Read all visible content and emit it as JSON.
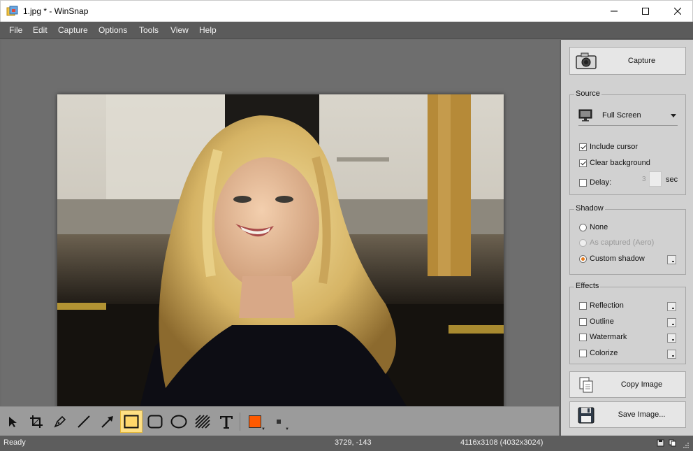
{
  "window": {
    "title": "1.jpg * - WinSnap",
    "app_icon": "winsnap-icon",
    "controls": [
      "minimize-icon",
      "maximize-icon",
      "close-icon"
    ]
  },
  "menu": [
    "File",
    "Edit",
    "Capture",
    "Options",
    "Tools",
    "View",
    "Help"
  ],
  "toolbar": {
    "tools": [
      "pointer-icon",
      "crop-icon",
      "pen-icon",
      "line-icon",
      "arrow-icon",
      "highlight-rectangle-icon",
      "rounded-rectangle-icon",
      "ellipse-icon",
      "hatch-icon",
      "text-icon"
    ],
    "active_tool": "highlight-rectangle-icon",
    "color": "#ff5a00"
  },
  "panel": {
    "capture_label": "Capture",
    "source": {
      "title": "Source",
      "selected": "Full Screen",
      "include_cursor": {
        "label": "Include cursor",
        "checked": true
      },
      "clear_background": {
        "label": "Clear background",
        "checked": true
      },
      "delay": {
        "label": "Delay:",
        "checked": false,
        "value": "3",
        "unit": "sec"
      }
    },
    "shadow": {
      "title": "Shadow",
      "none": "None",
      "as_captured": "As captured (Aero)",
      "custom": "Custom shadow",
      "selected": "Custom shadow"
    },
    "effects": {
      "title": "Effects",
      "reflection": "Reflection",
      "outline": "Outline",
      "watermark": "Watermark",
      "colorize": "Colorize"
    },
    "copy_label": "Copy Image",
    "save_label": "Save Image..."
  },
  "status": {
    "state": "Ready",
    "cursor": "3729, -143",
    "dimensions": "4116x3108 (4032x3024)"
  }
}
